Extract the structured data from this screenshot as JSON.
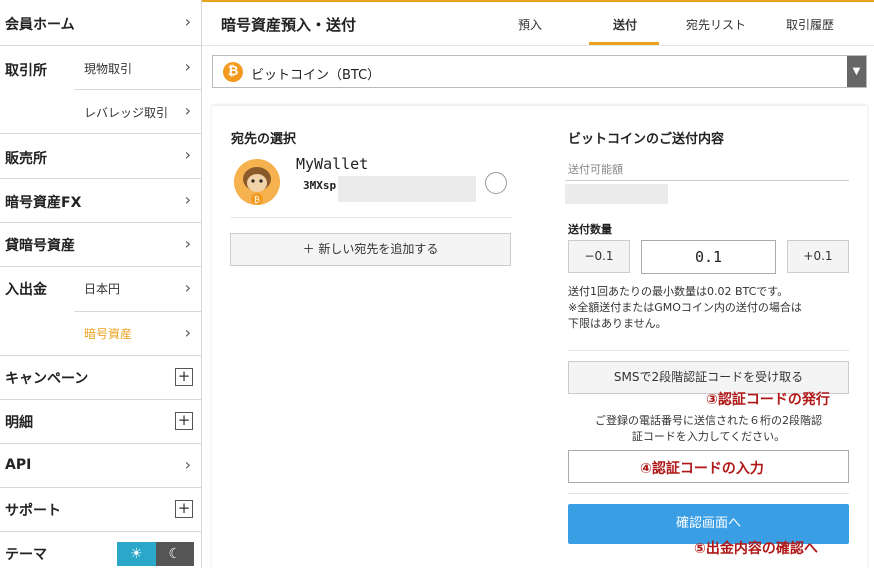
{
  "sidebar": {
    "member_home": "会員ホーム",
    "exchange": "取引所",
    "exchange_spot": "現物取引",
    "exchange_leverage": "レバレッジ取引",
    "sales": "販売所",
    "crypto_fx": "暗号資産FX",
    "lending": "貸暗号資産",
    "deposit_withdraw": "入出金",
    "dw_jpy": "日本円",
    "dw_crypto": "暗号資産",
    "campaign": "キャンペーン",
    "statement": "明細",
    "api": "API",
    "support": "サポート",
    "theme": "テーマ",
    "active_color": "#e9a21c"
  },
  "header": {
    "title": "暗号資産預入・送付",
    "tabs": [
      "預入",
      "送付",
      "宛先リスト",
      "取引履歴"
    ],
    "active_tab": "送付"
  },
  "coin_select": {
    "value": "ビットコイン（BTC）",
    "icon": "bitcoin-icon"
  },
  "destination": {
    "title": "宛先の選択",
    "wallet_name": "MyWallet",
    "wallet_addr_prefix": "3MXsp",
    "add_button": "＋ 新しい宛先を追加する"
  },
  "send": {
    "title": "ビットコインのご送付内容",
    "available_label": "送付可能額",
    "quantity_label": "送付数量",
    "minus_label": "−0.1",
    "plus_label": "+0.1",
    "quantity_value": "0.1",
    "note_line1": "送付1回あたりの最小数量は0.02 BTCです。",
    "note_line2": "※全額送付またはGMOコイン内の送付の場合は",
    "note_line3": "下限はありません。",
    "sms_button": "SMSで2段階認証コードを受け取る",
    "sms_note_line1": "ご登録の電話番号に送信された６桁の2段階認",
    "sms_note_line2": "証コードを入力してください。",
    "confirm_button": "確認画面へ"
  },
  "annotations": {
    "step3": "③認証コードの発行",
    "step4": "④認証コードの入力",
    "step5": "⑤出金内容の確認へ",
    "color": "#b01818"
  }
}
